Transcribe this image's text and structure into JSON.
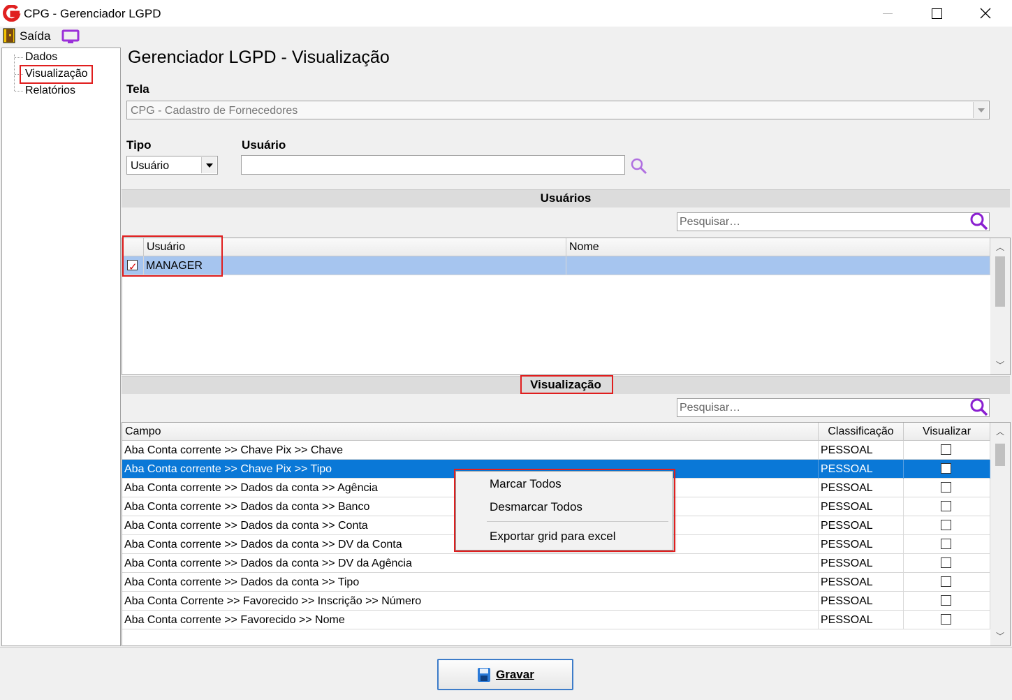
{
  "window": {
    "title": "CPG - Gerenciador LGPD",
    "logo_letter": "G"
  },
  "toolbar": {
    "exit_label": "Saída"
  },
  "sidebar": {
    "items": [
      {
        "label": "Dados"
      },
      {
        "label": "Visualização",
        "active": true
      },
      {
        "label": "Relatórios"
      }
    ]
  },
  "page": {
    "title": "Gerenciador LGPD - Visualização"
  },
  "form": {
    "tela_label": "Tela",
    "tela_value": "CPG - Cadastro de Fornecedores",
    "tipo_label": "Tipo",
    "tipo_value": "Usuário",
    "usuario_label": "Usuário",
    "usuario_value": ""
  },
  "users_section": {
    "title": "Usuários",
    "search_placeholder": "Pesquisar…",
    "columns": [
      "Usuário",
      "Nome"
    ],
    "rows": [
      {
        "usuario": "MANAGER",
        "nome": "",
        "checked": true
      }
    ]
  },
  "view_section": {
    "title": "Visualização",
    "search_placeholder": "Pesquisar…",
    "columns": [
      "Campo",
      "Classificação",
      "Visualizar"
    ],
    "rows": [
      {
        "campo": "Aba Conta corrente >> Chave Pix >> Chave",
        "classificacao": "PESSOAL",
        "visualizar": false
      },
      {
        "campo": "Aba Conta corrente >> Chave Pix >> Tipo",
        "classificacao": "PESSOAL",
        "visualizar": false,
        "selected": true
      },
      {
        "campo": "Aba Conta corrente >> Dados da conta >> Agência",
        "classificacao": "PESSOAL",
        "visualizar": false
      },
      {
        "campo": "Aba Conta corrente >> Dados da conta >> Banco",
        "classificacao": "PESSOAL",
        "visualizar": false
      },
      {
        "campo": "Aba Conta corrente >> Dados da conta >> Conta",
        "classificacao": "PESSOAL",
        "visualizar": false
      },
      {
        "campo": "Aba Conta corrente >> Dados da conta >> DV da  Conta",
        "classificacao": "PESSOAL",
        "visualizar": false
      },
      {
        "campo": "Aba Conta corrente >> Dados da conta >> DV da Agência",
        "classificacao": "PESSOAL",
        "visualizar": false
      },
      {
        "campo": "Aba Conta corrente >> Dados da conta >> Tipo",
        "classificacao": "PESSOAL",
        "visualizar": false
      },
      {
        "campo": "Aba Conta Corrente >> Favorecido >> Inscrição >> Número",
        "classificacao": "PESSOAL",
        "visualizar": false
      },
      {
        "campo": "Aba Conta corrente >> Favorecido >> Nome",
        "classificacao": "PESSOAL",
        "visualizar": false
      }
    ]
  },
  "context_menu": {
    "items": [
      "Marcar Todos",
      "Desmarcar Todos",
      "Exportar grid para excel"
    ]
  },
  "footer": {
    "save_label": "Gravar"
  },
  "colors": {
    "accent_red": "#e01e1e",
    "selection_blue": "#0a78d7",
    "icon_purple": "#9b30d9"
  }
}
